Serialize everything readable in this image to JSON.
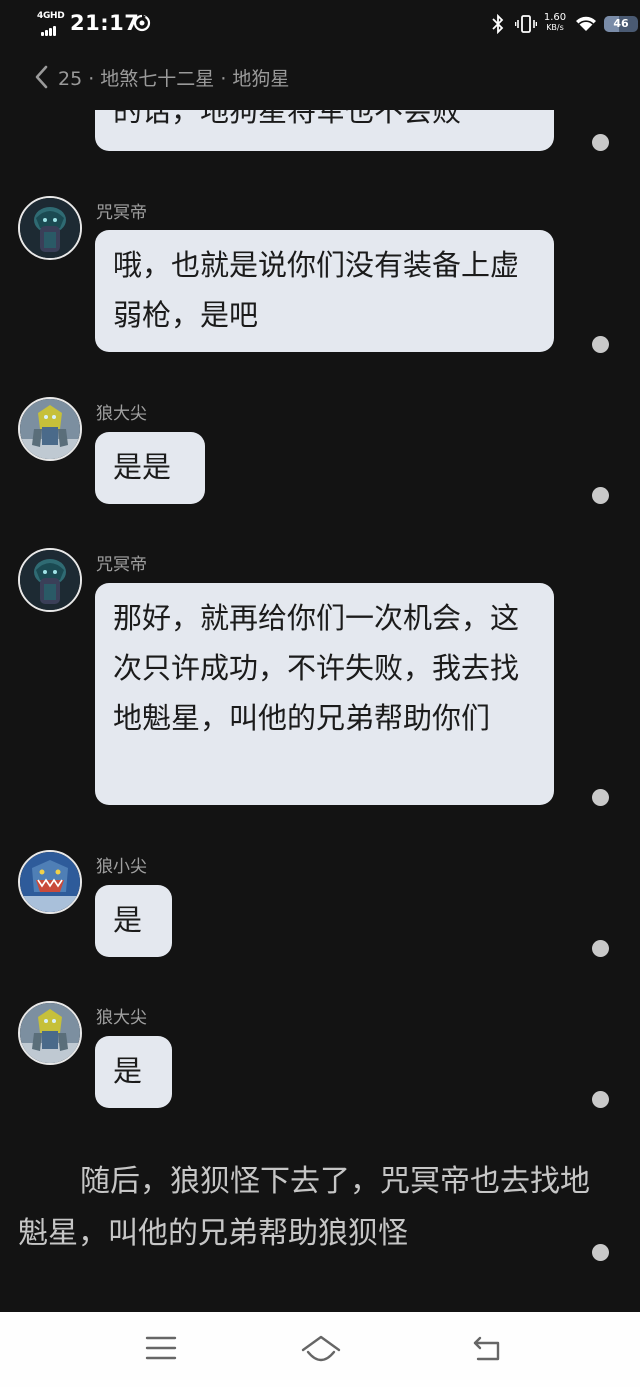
{
  "status_bar": {
    "network": "4GHD",
    "time": "21:17",
    "speed_value": "1.60",
    "speed_unit": "KB/s",
    "battery": "46"
  },
  "header": {
    "back_label": "25 · 地煞七十二星 · 地狗星"
  },
  "messages": [
    {
      "text": "的话，地狗星将军也不会败"
    },
    {
      "sender": "咒冥帝",
      "text": "哦，也就是说你们没有装备上虚弱枪，是吧"
    },
    {
      "sender": "狼大尖",
      "text": "是是"
    },
    {
      "sender": "咒冥帝",
      "text": "那好，就再给你们一次机会，这次只许成功，不许失败，我去找地魁星，叫他的兄弟帮助你们"
    },
    {
      "sender": "狼小尖",
      "text": "是"
    },
    {
      "sender": "狼大尖",
      "text": "是"
    }
  ],
  "narration": "随后，狼狈怪下去了，咒冥帝也去找地魁星，叫他的兄弟帮助狼狈怪",
  "icons": {
    "back": "chevron-left-icon",
    "menu": "menu-icon",
    "home": "home-icon",
    "return": "return-icon"
  },
  "colors": {
    "background": "#131313",
    "bubble": "#e4e8ef",
    "bubble_text": "#1b1b1b",
    "nav_bar": "#fefefe"
  }
}
